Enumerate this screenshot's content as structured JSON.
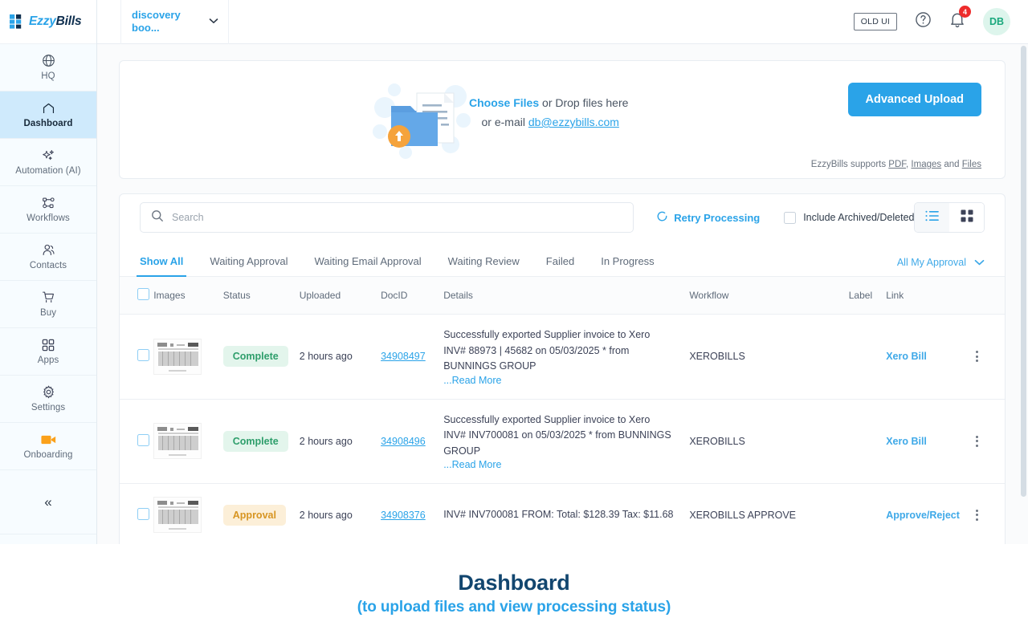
{
  "brand": {
    "logo_ezzy": "Ezzy",
    "logo_bills": "Bills",
    "accent_blue": "#2aa3e8",
    "dark_blue": "#12466f",
    "green": "#2e9e6b",
    "amber": "#d79522",
    "red": "#ee2b2b"
  },
  "sidebar": {
    "items": [
      {
        "label": "HQ",
        "icon": "globe-icon",
        "active": false
      },
      {
        "label": "Dashboard",
        "icon": "home-icon",
        "active": true
      },
      {
        "label": "Automation (AI)",
        "icon": "sparkle-icon",
        "active": false
      },
      {
        "label": "Workflows",
        "icon": "workflow-icon",
        "active": false
      },
      {
        "label": "Contacts",
        "icon": "contacts-icon",
        "active": false
      },
      {
        "label": "Buy",
        "icon": "cart-icon",
        "active": false
      },
      {
        "label": "Apps",
        "icon": "apps-grid-icon",
        "active": false
      },
      {
        "label": "Settings",
        "icon": "gear-icon",
        "active": false
      },
      {
        "label": "Onboarding",
        "icon": "video-icon",
        "active": false
      }
    ],
    "collapse_label": "«"
  },
  "topbar": {
    "company": "discovery boo...",
    "old_ui_label": "OLD UI",
    "help_icon": "question-circle-icon",
    "notification_icon": "bell-icon",
    "notification_count": "4",
    "avatar_initials": "DB"
  },
  "upload": {
    "choose_files": "Choose Files",
    "drop_text": " or Drop files here",
    "email_prefix": "or e-mail ",
    "email": "db@ezzybills.com",
    "advanced_upload_label": "Advanced Upload",
    "supports_prefix": "EzzyBills supports ",
    "supports_pdf": "PDF",
    "supports_images": "Images",
    "supports_files": "Files",
    "supports_and": " and "
  },
  "search": {
    "placeholder": "Search",
    "value": "",
    "icon": "search-icon"
  },
  "toolbar": {
    "retry_label": "Retry Processing",
    "retry_icon": "refresh-icon",
    "include_archived_label": "Include Archived/Deleted",
    "include_archived_checked": false,
    "list_view_icon": "list-view-icon",
    "grid_view_icon": "grid-view-icon",
    "active_view": "list"
  },
  "tabs": [
    {
      "label": "Show All",
      "active": true
    },
    {
      "label": "Waiting Approval",
      "active": false
    },
    {
      "label": "Waiting Email Approval",
      "active": false
    },
    {
      "label": "Waiting Review",
      "active": false
    },
    {
      "label": "Failed",
      "active": false
    },
    {
      "label": "In Progress",
      "active": false
    }
  ],
  "approval_filter": {
    "label": "All My Approval",
    "icon": "chevron-down-icon"
  },
  "table": {
    "headers": [
      "Images",
      "Status",
      "Uploaded",
      "DocID",
      "Details",
      "Workflow",
      "Label",
      "Link"
    ],
    "rows": [
      {
        "status": "Complete",
        "status_type": "complete",
        "uploaded": "2 hours ago",
        "docid": "34908497",
        "details": "Successfully exported Supplier invoice to Xero INV# 88973 | 45682 on 05/03/2025 * from BUNNINGS GROUP",
        "read_more": "...Read More",
        "workflow": "XEROBILLS",
        "label": "",
        "link": "Xero Bill"
      },
      {
        "status": "Complete",
        "status_type": "complete",
        "uploaded": "2 hours ago",
        "docid": "34908496",
        "details": "Successfully exported Supplier invoice to Xero INV# INV700081 on 05/03/2025 * from BUNNINGS GROUP",
        "read_more": "...Read More",
        "workflow": "XEROBILLS",
        "label": "",
        "link": "Xero Bill"
      },
      {
        "status": "Approval",
        "status_type": "approval",
        "uploaded": "2 hours ago",
        "docid": "34908376",
        "details": "INV# INV700081 FROM: Total: $128.39 Tax: $11.68",
        "read_more": "",
        "workflow": "XEROBILLS APPROVE",
        "label": "",
        "link": "Approve/Reject"
      }
    ]
  },
  "caption": {
    "title": "Dashboard",
    "subtitle": "(to upload files and view processing status)"
  }
}
